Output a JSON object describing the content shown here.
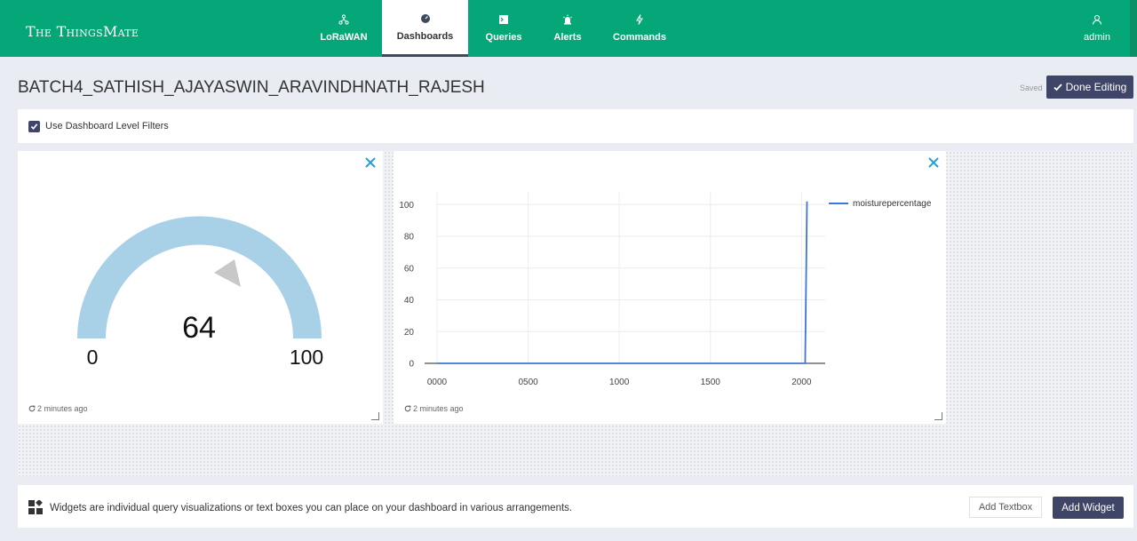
{
  "brand": "The ThingsMate",
  "nav": {
    "lorawan": "LoRaWAN",
    "dashboards": "Dashboards",
    "queries": "Queries",
    "alerts": "Alerts",
    "commands": "Commands",
    "admin": "admin"
  },
  "colors": {
    "header": "#05a677",
    "accent": "#3f4566",
    "gauge": "#a8d0e6",
    "line": "#3b78d8"
  },
  "dashboard": {
    "title": "BATCH4_SATHISH_AJAYASWIN_ARAVINDHNATH_RAJESH",
    "saved": "Saved",
    "done_editing": "Done Editing",
    "filters_label": "Use Dashboard Level Filters",
    "filters_checked": true
  },
  "gauge_widget": {
    "value": "64",
    "min": "0",
    "max": "100",
    "updated": "2 minutes ago"
  },
  "chart_widget": {
    "updated": "2 minutes ago"
  },
  "chart_data": {
    "type": "line",
    "series": [
      {
        "name": "moisturepercentage",
        "x": [
          0,
          2000,
          2020,
          2030
        ],
        "y": [
          0,
          0,
          0,
          102
        ]
      }
    ],
    "x_ticks": [
      "0000",
      "0500",
      "1000",
      "1500",
      "2000"
    ],
    "y_ticks": [
      "0",
      "20",
      "40",
      "60",
      "80",
      "100"
    ],
    "xlim": [
      0,
      2130
    ],
    "ylim": [
      0,
      108
    ],
    "legend": "top-right",
    "grid": true
  },
  "footer": {
    "text": "Widgets are individual query visualizations or text boxes you can place on your dashboard in various arrangements.",
    "add_textbox": "Add Textbox",
    "add_widget": "Add Widget"
  }
}
